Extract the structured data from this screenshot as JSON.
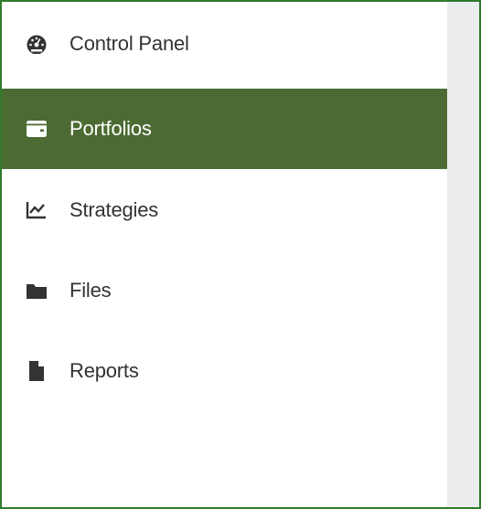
{
  "sidebar": {
    "items": [
      {
        "label": "Control Panel",
        "icon": "tachometer-icon",
        "active": false
      },
      {
        "label": "Portfolios",
        "icon": "wallet-icon",
        "active": true
      },
      {
        "label": "Strategies",
        "icon": "line-chart-icon",
        "active": false
      },
      {
        "label": "Files",
        "icon": "folder-icon",
        "active": false
      },
      {
        "label": "Reports",
        "icon": "file-icon",
        "active": false
      }
    ]
  },
  "colors": {
    "frame_border": "#2f7a2c",
    "active_background": "#4c6b33",
    "active_accent": "#7bbd45",
    "icon": "#333333",
    "text": "#333333",
    "active_text": "#ffffff",
    "right_panel": "#ecedef"
  }
}
